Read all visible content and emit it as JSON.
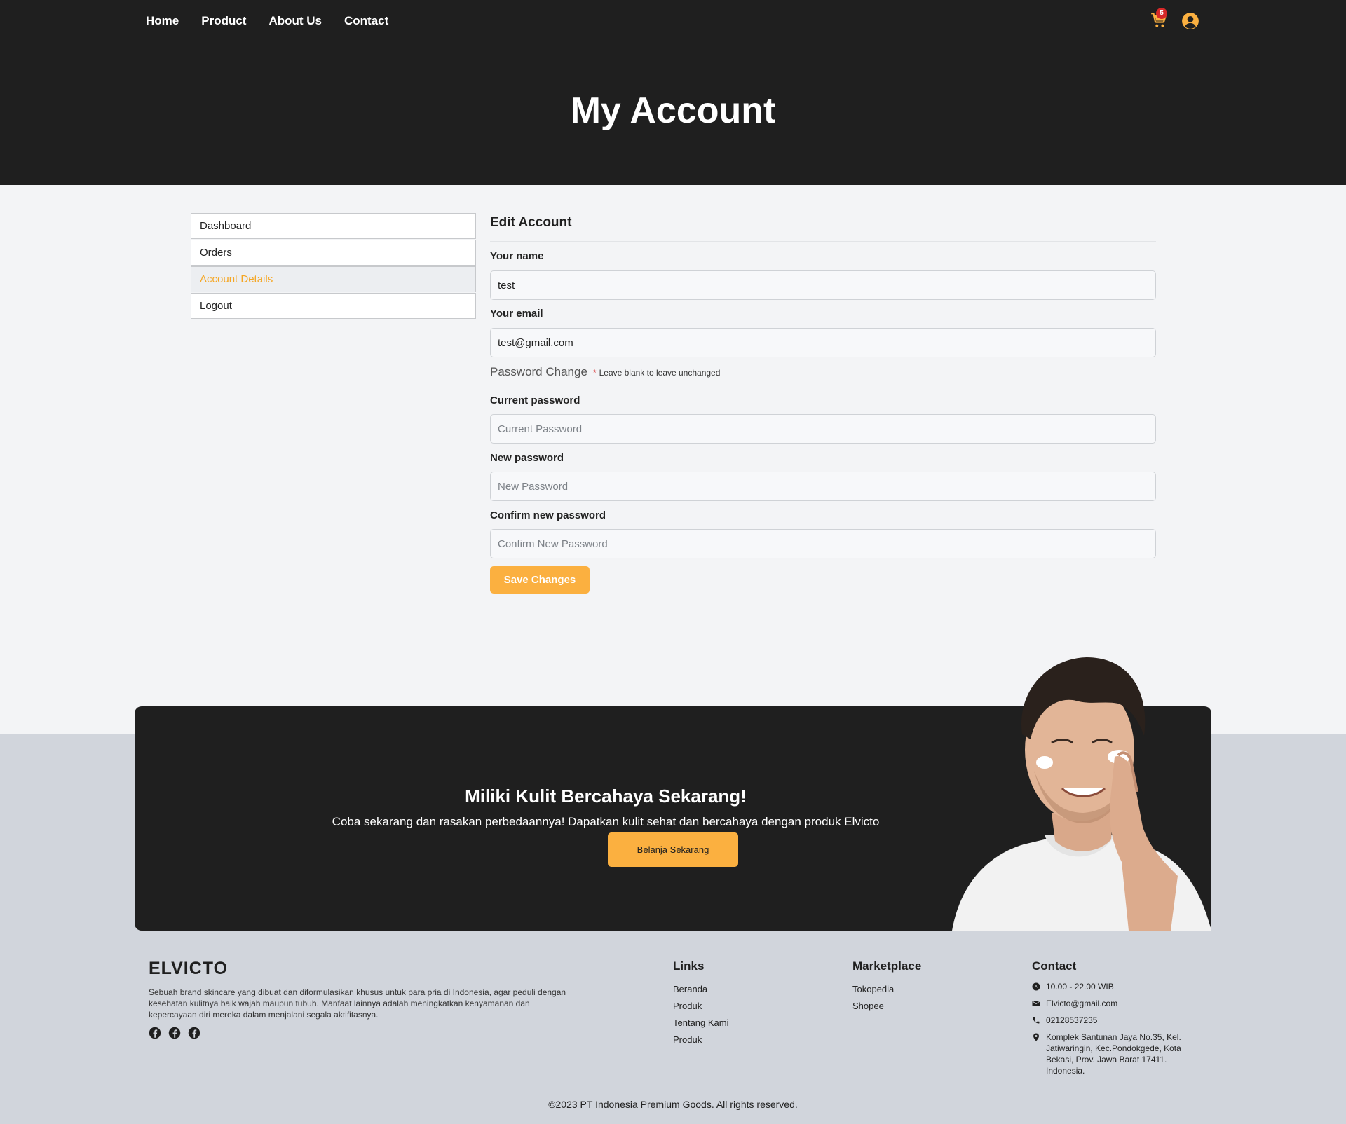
{
  "nav": {
    "items": [
      {
        "label": "Home"
      },
      {
        "label": "Product"
      },
      {
        "label": "About Us"
      },
      {
        "label": "Contact"
      }
    ],
    "cart_count": "5"
  },
  "hero": {
    "title": "My Account"
  },
  "sidebar": {
    "items": [
      {
        "label": "Dashboard"
      },
      {
        "label": "Orders"
      },
      {
        "label": "Account Details"
      },
      {
        "label": "Logout"
      }
    ]
  },
  "form": {
    "heading": "Edit Account",
    "name_label": "Your name",
    "name_value": "test",
    "email_label": "Your email",
    "email_value": "test@gmail.com",
    "password_section": "Password Change",
    "password_star": "*",
    "password_note": "Leave blank to leave unchanged",
    "current_label": "Current password",
    "current_placeholder": "Current Password",
    "new_label": "New password",
    "new_placeholder": "New Password",
    "confirm_label": "Confirm new password",
    "confirm_placeholder": "Confirm New Password",
    "save_label": "Save Changes"
  },
  "cta": {
    "title": "Miliki Kulit Bercahaya Sekarang!",
    "text": "Coba sekarang dan rasakan perbedaannya! Dapatkan kulit sehat dan bercahaya dengan produk Elvicto",
    "button": "Belanja Sekarang"
  },
  "footer": {
    "brand": "ELVICTO",
    "description": "Sebuah brand skincare yang dibuat dan diformulasikan khusus untuk para pria di Indonesia, agar peduli dengan kesehatan kulitnya baik wajah maupun tubuh. Manfaat lainnya adalah meningkatkan kenyamanan dan kepercayaan diri mereka dalam menjalani segala aktifitasnya.",
    "links_title": "Links",
    "links": [
      "Beranda",
      "Produk",
      "Tentang Kami",
      "Produk"
    ],
    "marketplace_title": "Marketplace",
    "marketplace": [
      "Tokopedia",
      "Shopee"
    ],
    "contact_title": "Contact",
    "contact": {
      "hours": "10.00 - 22.00 WIB",
      "email": "Elvicto@gmail.com",
      "phone": "02128537235",
      "address": "Komplek Santunan Jaya No.35, Kel. Jatiwaringin, Kec.Pondokgede, Kota Bekasi, Prov. Jawa Barat 17411. Indonesia."
    },
    "copyright": "©2023 PT Indonesia Premium Goods. All rights reserved."
  },
  "colors": {
    "dark": "#1f1f1f",
    "accent": "#fbb040",
    "active_text": "#f5a623",
    "badge": "#d62828",
    "page_bg": "#f3f4f6",
    "footer_bg": "#d1d5dc"
  }
}
